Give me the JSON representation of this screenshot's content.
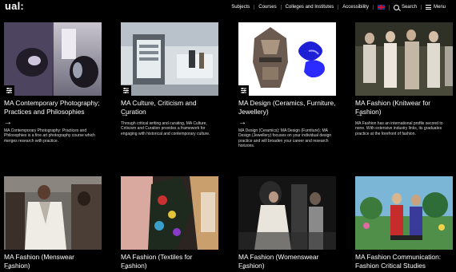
{
  "header": {
    "logo": "ual:",
    "nav": [
      "Subjects",
      "Courses",
      "Colleges and Institutes",
      "Accessibility"
    ],
    "search_label": "Search",
    "menu_label": "Menu",
    "flag_icon": "union-jack-flag-icon"
  },
  "cards": [
    {
      "title": "MA Contemporary Photography; Practices and Philosophies",
      "arrow": "→",
      "description": "MA Contemporary Photography: Practices and Philosophies is a fine art photography course which merges research with practice."
    },
    {
      "title": "MA Culture, Criticism and Curation",
      "arrow": "→",
      "description": "Through critical writing and curating, MA Culture, Criticism and Curation provides a framework for engaging with historical and contemporary culture."
    },
    {
      "title": "MA Design (Ceramics, Furniture, Jewellery)",
      "arrow": "→",
      "description": "MA Design (Ceramics); MA Design (Furniture); MA Design (Jewellery) focuses on your individual design practice and will broaden your career and research horizons."
    },
    {
      "title": "MA Fashion (Knitwear for Fashion)",
      "arrow": "→",
      "description": "MA Fashion has an international profile second to none. With extensive industry links, its graduates practice at the forefront of fashion."
    },
    {
      "title": "MA Fashion (Menswear Fashion)",
      "arrow": "→",
      "description": ""
    },
    {
      "title": "MA Fashion (Textiles for Fashion)",
      "arrow": "→",
      "description": ""
    },
    {
      "title": "MA Fashion (Womenswear Fashion)",
      "arrow": "→",
      "description": ""
    },
    {
      "title": "MA Fashion Communication: Fashion Critical Studies",
      "arrow": "→",
      "description": ""
    }
  ]
}
